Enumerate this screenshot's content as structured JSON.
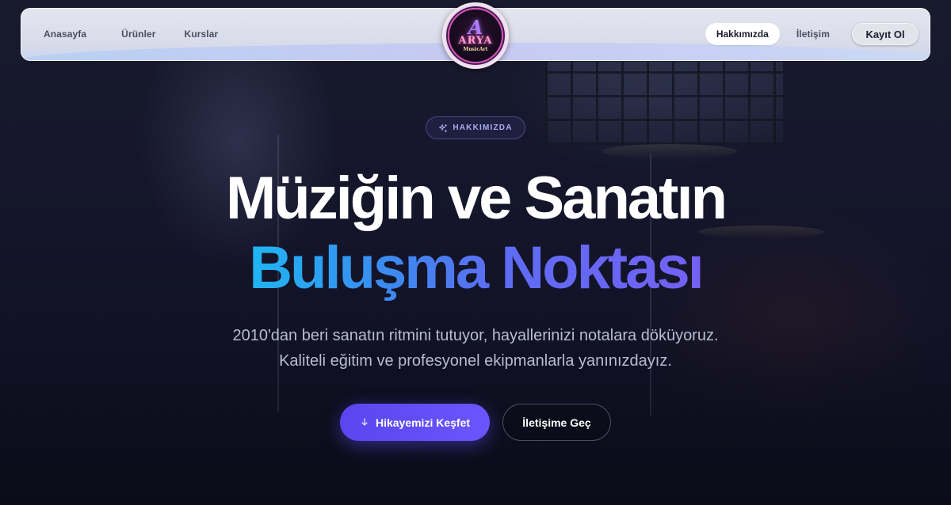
{
  "navbar": {
    "left_links": [
      {
        "label": "Anasayfa"
      },
      {
        "label": "Ürünler"
      },
      {
        "label": "Kurslar"
      }
    ],
    "right_links": {
      "active": "Hakkımızda",
      "contact": "İletişim",
      "register": "Kayıt Ol"
    },
    "logo": {
      "letter": "A",
      "word": "ARYA",
      "sub": "MusicArt"
    }
  },
  "hero": {
    "badge": "HAKKIMIZDA",
    "title_line1": "Müziğin ve Sanatın",
    "title_line2": "Buluşma Noktası",
    "subtitle_line1": "2010'dan beri sanatın ritmini tutuyor, hayallerinizi notalara döküyoruz.",
    "subtitle_line2": "Kaliteli eğitim ve profesyonel ekipmanlarla yanınızdayız.",
    "primary_cta": "Hikayemizi Keşfet",
    "secondary_cta": "İletişime Geç"
  },
  "colors": {
    "accent": "#6a55ff",
    "gradient_start": "#1fb6f2",
    "gradient_end": "#7361f4",
    "background": "#14152a"
  },
  "icons": {
    "badge_icon": "sparkles-icon",
    "primary_cta_icon": "arrow-down-icon"
  }
}
